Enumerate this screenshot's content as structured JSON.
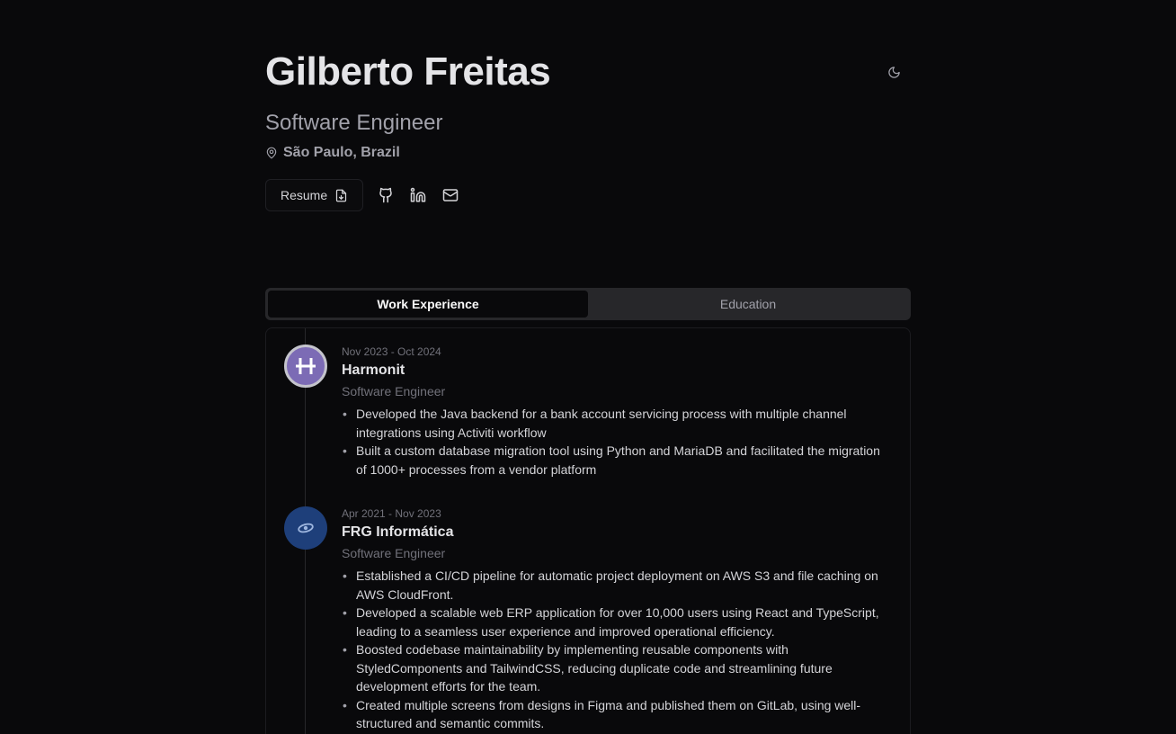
{
  "header": {
    "name": "Gilberto Freitas",
    "role": "Software Engineer",
    "location": "São Paulo, Brazil",
    "theme_icon": "moon-icon"
  },
  "links": {
    "resume_label": "Resume",
    "icons": [
      "file-download-icon",
      "github-icon",
      "linkedin-icon",
      "mail-icon"
    ]
  },
  "tabs": [
    {
      "label": "Work Experience",
      "active": true
    },
    {
      "label": "Education",
      "active": false
    }
  ],
  "experience": [
    {
      "dates": "Nov 2023 - Oct 2024",
      "company": "Harmonit",
      "position": "Software Engineer",
      "logo_color": "#7c6bb5",
      "bullets": [
        "Developed the Java backend for a bank account servicing process with multiple channel integrations using Activiti workflow",
        "Built a custom database migration tool using Python and MariaDB and facilitated the migration of 1000+ processes from a vendor platform"
      ]
    },
    {
      "dates": "Apr 2021 - Nov 2023",
      "company": "FRG Informática",
      "position": "Software Engineer",
      "logo_color": "#1e3f7a",
      "bullets": [
        "Established a CI/CD pipeline for automatic project deployment on AWS S3 and file caching on AWS CloudFront.",
        "Developed a scalable web ERP application for over 10,000 users using React and TypeScript, leading to a seamless user experience and improved operational efficiency.",
        "Boosted codebase maintainability by implementing reusable components with StyledComponents and TailwindCSS, reducing duplicate code and streamlining future development efforts for the team.",
        "Created multiple screens from designs in Figma and published them on GitLab, using well-structured and semantic commits."
      ]
    }
  ],
  "colors": {
    "background": "#09090b",
    "text_primary": "#e4e4e7",
    "text_muted": "#a1a1aa",
    "tabs_bg": "#27272a"
  }
}
